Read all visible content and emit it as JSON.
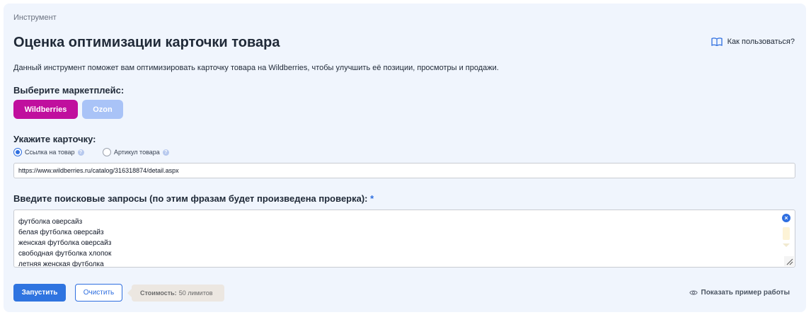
{
  "breadcrumb": "Инструмент",
  "title": "Оценка оптимизации карточки товара",
  "help_link": {
    "label": "Как пользоваться?",
    "icon": "book-icon"
  },
  "description": "Данный инструмент поможет вам оптимизировать карточку товара на Wildberries, чтобы улучшить её позиции, просмотры и продажи.",
  "marketplace": {
    "label": "Выберите маркетплейс:",
    "options": [
      "Wildberries",
      "Ozon"
    ],
    "selected": "Wildberries",
    "colors": {
      "wildberries": "#c00f9e",
      "ozon": "#a9c3f7"
    }
  },
  "card_input": {
    "label": "Укажите карточку:",
    "options": [
      {
        "label": "Ссылка на товар",
        "selected": true
      },
      {
        "label": "Артикул товара",
        "selected": false
      }
    ],
    "help_glyph": "?",
    "value": "https://www.wildberries.ru/catalog/316318874/detail.aspx"
  },
  "queries": {
    "label": "Введите поисковые запросы (по этим фразам будет произведена проверка):",
    "required_mark": "*",
    "lines": [
      "футболка оверсайз",
      "белая футболка оверсайз",
      "женская футболка оверсайз",
      "свободная футболка хлопок",
      "летняя женская футболка"
    ],
    "clear_glyph": "×"
  },
  "actions": {
    "run": "Запустить",
    "clear": "Очистить",
    "cost_label": "Стоимость:",
    "cost_value": "50 лимитов",
    "example": "Показать пример работы"
  },
  "colors": {
    "accent": "#2f74e0",
    "panel": "#f0f5fd"
  }
}
